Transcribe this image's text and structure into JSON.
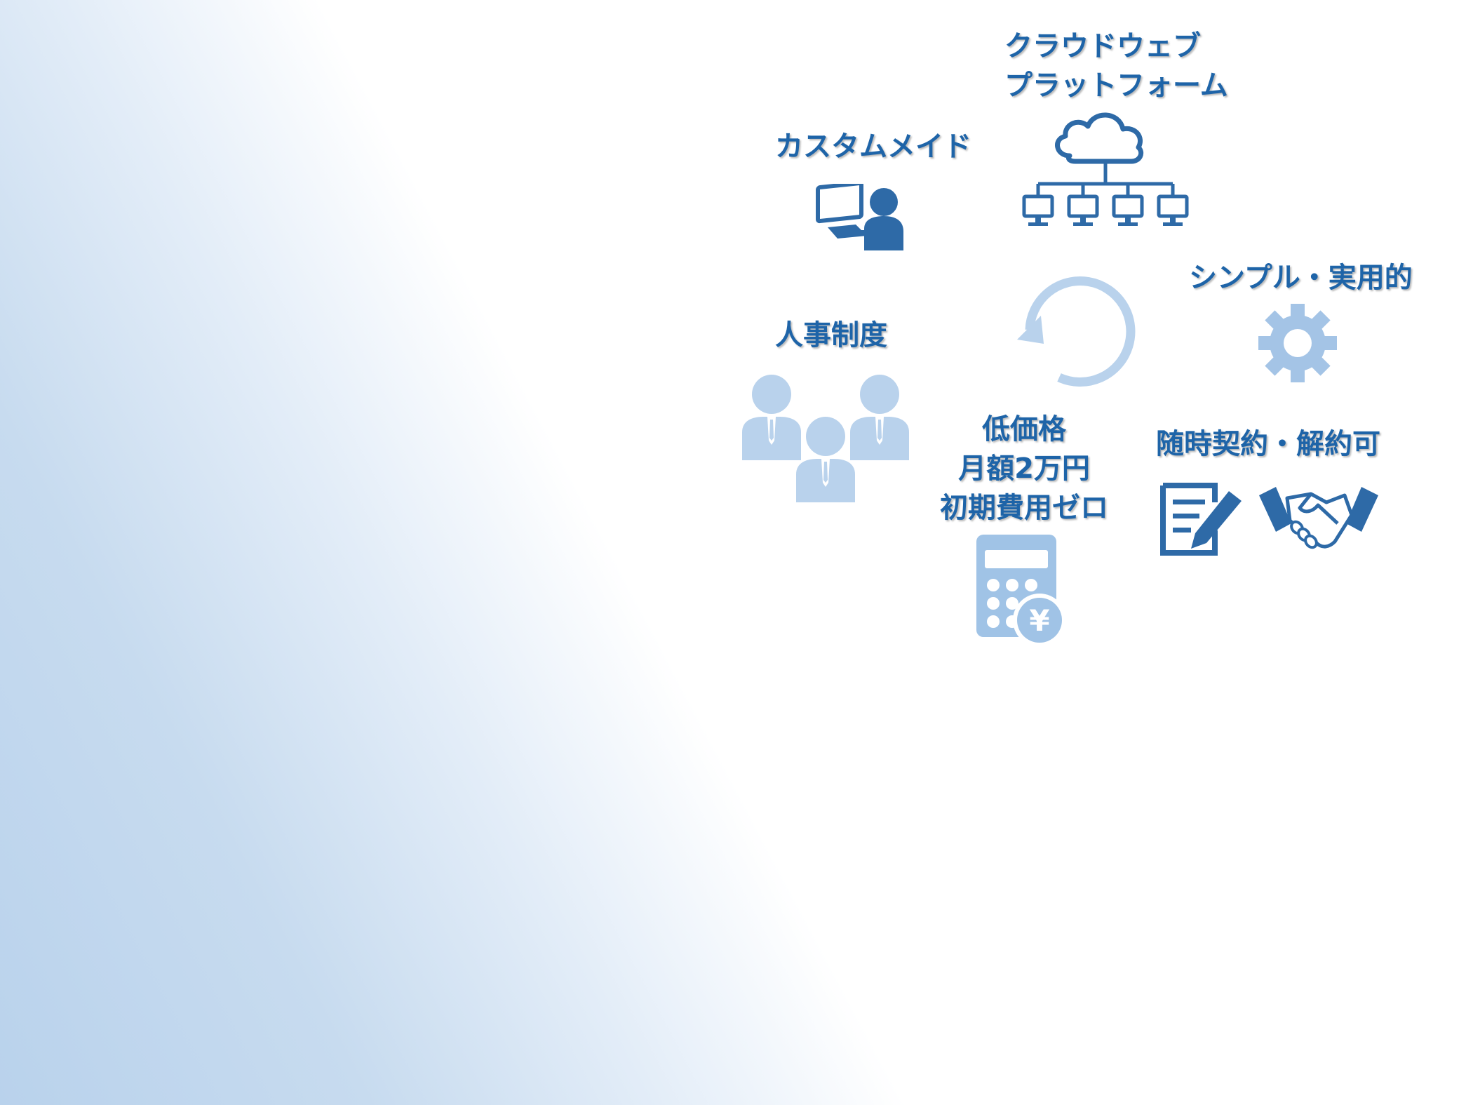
{
  "colors": {
    "text": "#1e64a8",
    "icon_dark": "#2e6aa7",
    "icon_light": "#b9d2ec",
    "icon_mid": "#a4c4e6",
    "calc": "#a0c3e6"
  },
  "features": {
    "cloud": {
      "line1": "クラウドウェブ",
      "line2": "プラットフォーム",
      "icon": "cloud-network-icon"
    },
    "custom": {
      "label": "カスタムメイド",
      "icon": "user-computer-icon"
    },
    "simple": {
      "label": "シンプル・実用的",
      "icon": "gear-icon"
    },
    "hr": {
      "label": "人事制度",
      "icon": "people-group-icon"
    },
    "price": {
      "line1": "低価格",
      "line2": "月額2万円",
      "line3": "初期費用ゼロ",
      "icon": "calculator-yen-icon"
    },
    "contract": {
      "label": "随時契約・解約可",
      "icon": "contract-handshake-icon"
    }
  },
  "cycle": {
    "icon": "cycle-arrow-icon"
  },
  "calc_symbol": "¥"
}
